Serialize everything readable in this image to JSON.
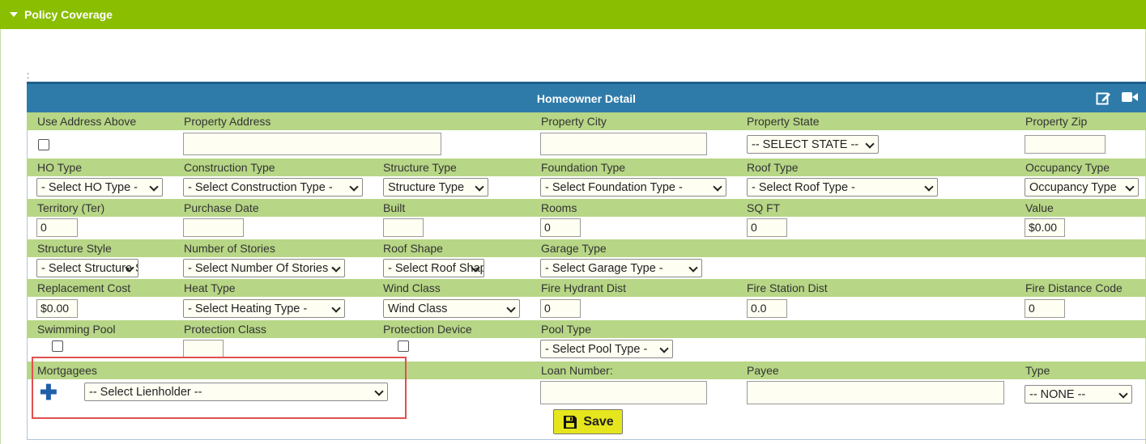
{
  "section": {
    "title": "Policy Coverage"
  },
  "panel": {
    "title": "Homeowner Detail",
    "marker": ":"
  },
  "rows": [
    {
      "labels": [
        "Use Address Above",
        "Property Address",
        "Property City",
        "Property State",
        "Property Zip"
      ]
    },
    {
      "labels": [
        "HO Type",
        "Construction Type",
        "Structure Type",
        "Foundation Type",
        "Roof Type",
        "Occupancy Type"
      ]
    },
    {
      "labels": [
        "Territory (Ter)",
        "Purchase Date",
        "Built",
        "Rooms",
        "SQ FT",
        "Value"
      ]
    },
    {
      "labels": [
        "Structure Style",
        "Number of Stories",
        "Roof Shape",
        "Garage Type"
      ]
    },
    {
      "labels": [
        "Replacement Cost",
        "Heat Type",
        "Wind Class",
        "Fire Hydrant Dist",
        "Fire Station Dist",
        "Fire Distance Code"
      ]
    },
    {
      "labels": [
        "Swimming Pool",
        "Protection Class",
        "Protection Device",
        "Pool Type"
      ]
    },
    {
      "labels": [
        "Mortgagees",
        "Loan Number:",
        "Payee",
        "Type"
      ]
    }
  ],
  "fields": {
    "property_state": "-- SELECT STATE --",
    "ho_type": "- Select HO Type -",
    "construction_type": "- Select Construction Type -",
    "structure_type": "Structure Type",
    "foundation_type": "- Select Foundation Type -",
    "roof_type": "- Select Roof Type -",
    "occupancy_type": "Occupancy Type",
    "territory": "0",
    "rooms": "0",
    "sqft": "0",
    "value": "$0.00",
    "structure_style": "- Select Structure Style -",
    "number_of_stories": "- Select Number Of Stories -",
    "roof_shape": "- Select Roof Shape -",
    "garage_type": "- Select Garage Type -",
    "replacement_cost": "$0.00",
    "heat_type": "- Select Heating Type -",
    "wind_class": "Wind Class",
    "fire_hydrant_dist": "0",
    "fire_station_dist": "0.0",
    "fire_distance_code": "0",
    "pool_type": "- Select Pool Type -",
    "lienholder": "-- Select Lienholder --",
    "mortgagee_type": "-- NONE --"
  },
  "actions": {
    "save_label": "Save"
  }
}
